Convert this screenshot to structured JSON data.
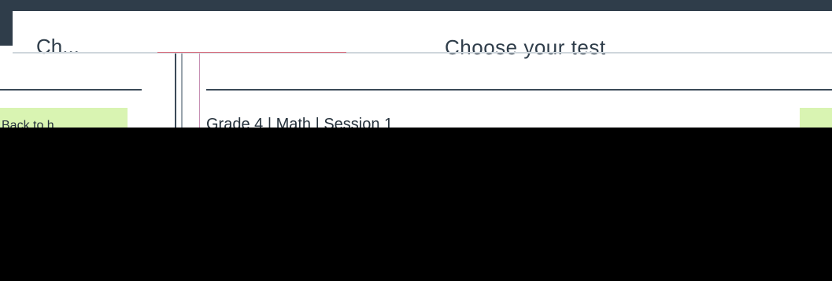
{
  "header": {
    "left_title": "Ch...",
    "right_title": "Choose your test"
  },
  "sidebar": {
    "back_button_label": "Back to h..."
  },
  "main": {
    "test_title": "Grade 4 | Math | Session 1"
  },
  "colors": {
    "frame": "#2f3d4a",
    "panel": "#ffffff",
    "accent_green": "#d9f4b2",
    "text": "#26323c",
    "overlay": "#000000"
  }
}
